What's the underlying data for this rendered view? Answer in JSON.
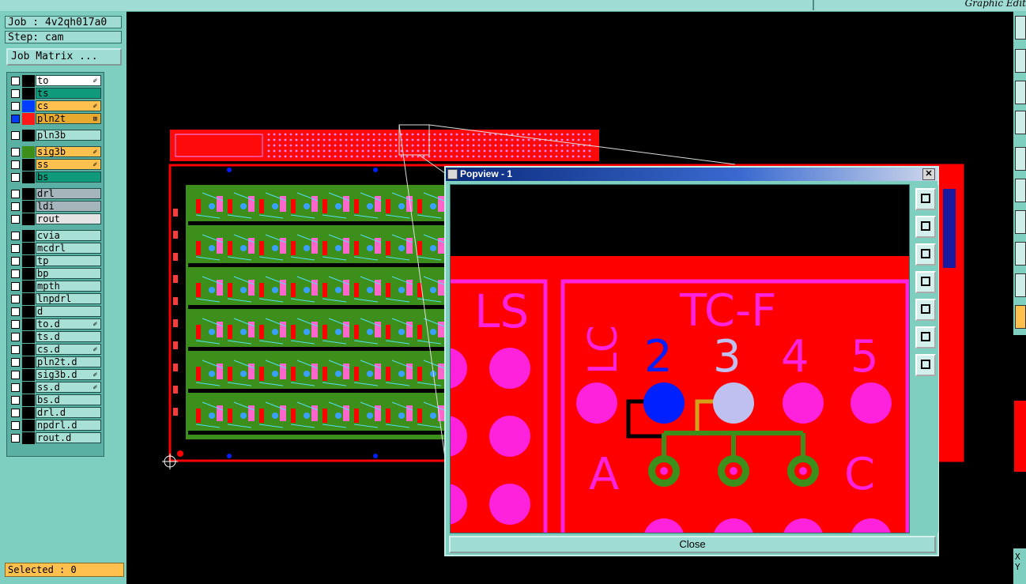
{
  "app": {
    "title": "Graphic Edit"
  },
  "job": {
    "label": "Job : 4v2qh017a0",
    "step": "Step: cam"
  },
  "buttons": {
    "job_matrix": "Job Matrix ..."
  },
  "layers": [
    {
      "name": "to",
      "color": "#ffffff",
      "mark": "✐",
      "swatch": "#000000"
    },
    {
      "name": "ts",
      "color": "#0f9a7b",
      "mark": "",
      "swatch": "#000000"
    },
    {
      "name": "cs",
      "color": "#ffc04d",
      "mark": "✐",
      "swatch": "#003dff"
    },
    {
      "name": "pln2t",
      "color": "#e8a92f",
      "mark": "⊞",
      "swatch": "#ff1a1a"
    },
    {
      "name": "pln3b",
      "color": "#a8e0d6",
      "mark": "",
      "swatch": "#000000"
    },
    {
      "name": "sig3b",
      "color": "#ffc04d",
      "mark": "✐",
      "swatch": "#3c8f1a"
    },
    {
      "name": "ss",
      "color": "#ffc04d",
      "mark": "✐",
      "swatch": "#000000"
    },
    {
      "name": "bs",
      "color": "#0f9a7b",
      "mark": "",
      "swatch": "#000000"
    },
    {
      "name": "drl",
      "color": "#a6b4bb",
      "mark": "",
      "swatch": "#000000"
    },
    {
      "name": "ldi",
      "color": "#a6b4bb",
      "mark": "",
      "swatch": "#000000"
    },
    {
      "name": "rout",
      "color": "#e4e4e4",
      "mark": "",
      "swatch": "#000000"
    },
    {
      "name": "cvia",
      "color": "#a8e0d6",
      "mark": "",
      "swatch": "#000000"
    },
    {
      "name": "mcdrl",
      "color": "#a8e0d6",
      "mark": "",
      "swatch": "#000000"
    },
    {
      "name": "tp",
      "color": "#a8e0d6",
      "mark": "",
      "swatch": "#000000"
    },
    {
      "name": "bp",
      "color": "#a8e0d6",
      "mark": "",
      "swatch": "#000000"
    },
    {
      "name": "mpth",
      "color": "#a8e0d6",
      "mark": "",
      "swatch": "#000000"
    },
    {
      "name": "lnpdrl",
      "color": "#a8e0d6",
      "mark": "",
      "swatch": "#000000"
    },
    {
      "name": "d",
      "color": "#a8e0d6",
      "mark": "",
      "swatch": "#000000"
    },
    {
      "name": "to.d",
      "color": "#a8e0d6",
      "mark": "✐",
      "swatch": "#000000"
    },
    {
      "name": "ts.d",
      "color": "#a8e0d6",
      "mark": "",
      "swatch": "#000000"
    },
    {
      "name": "cs.d",
      "color": "#a8e0d6",
      "mark": "✐",
      "swatch": "#000000"
    },
    {
      "name": "pln2t.d",
      "color": "#a8e0d6",
      "mark": "",
      "swatch": "#000000"
    },
    {
      "name": "sig3b.d",
      "color": "#a8e0d6",
      "mark": "✐",
      "swatch": "#000000"
    },
    {
      "name": "ss.d",
      "color": "#a8e0d6",
      "mark": "✐",
      "swatch": "#000000"
    },
    {
      "name": "bs.d",
      "color": "#a8e0d6",
      "mark": "",
      "swatch": "#000000"
    },
    {
      "name": "drl.d",
      "color": "#a8e0d6",
      "mark": "",
      "swatch": "#000000"
    },
    {
      "name": "npdrl.d",
      "color": "#a8e0d6",
      "mark": "",
      "swatch": "#000000"
    },
    {
      "name": "rout.d",
      "color": "#a8e0d6",
      "mark": "",
      "swatch": "#000000"
    }
  ],
  "status": {
    "selected": "Selected : 0"
  },
  "popview": {
    "title": "Popview - 1",
    "close_x": "✕",
    "close_label": "Close",
    "labels": {
      "ls": "LS",
      "tcf": "TC-F",
      "lc": "LC",
      "n2": "2",
      "n3": "3",
      "n4": "4",
      "n5": "5",
      "a": "A",
      "c": "C"
    },
    "toolbar_icons": [
      "zoom-fit-icon",
      "pan-up-icon",
      "pan-down-icon",
      "pan-left-icon",
      "pan-right-icon",
      "zoom-in-icon",
      "zoom-out-icon"
    ]
  },
  "colors": {
    "board_red": "#ff0000",
    "pad_magenta": "#ff22dd",
    "trace_green": "#3c8f1a",
    "selected_blue": "#0020ff",
    "selected_lavender": "#c0c0f0"
  }
}
